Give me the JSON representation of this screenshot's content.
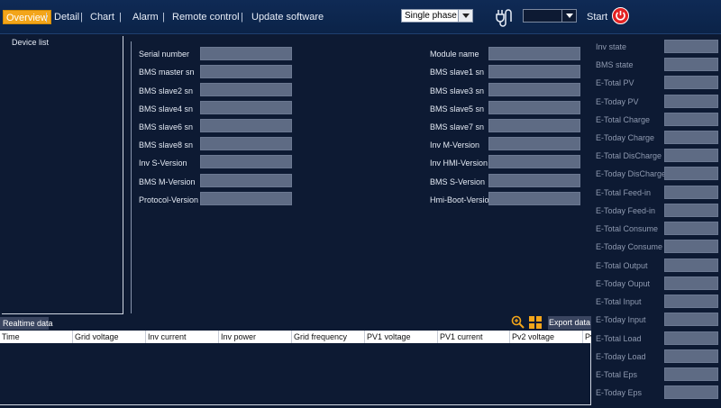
{
  "nav": {
    "tabs": [
      "Overview",
      "Detail",
      "Chart",
      "Alarm",
      "Remote control",
      "Update software"
    ],
    "phase_select": "Single phase",
    "port_select": "",
    "start_label": "Start"
  },
  "device_list": {
    "title": "Device list"
  },
  "info": {
    "left_labels": [
      "Serial number",
      "BMS master sn",
      "BMS slave2 sn",
      "BMS slave4 sn",
      "BMS slave6 sn",
      "BMS slave8 sn",
      "Inv S-Version",
      "BMS M-Version",
      "Protocol-Version"
    ],
    "right_labels": [
      "Module name",
      "BMS slave1 sn",
      "BMS slave3 sn",
      "BMS slave5 sn",
      "BMS slave7 sn",
      "Inv M-Version",
      "Inv HMI-Version",
      "BMS S-Version",
      "Hmi-Boot-Version"
    ]
  },
  "stats": {
    "labels": [
      "Inv state",
      "BMS state",
      "E-Total PV",
      "E-Today PV",
      "E-Total Charge",
      "E-Today Charge",
      "E-Total DisCharge",
      "E-Today DisCharge",
      "E-Total Feed-in",
      "E-Today Feed-in",
      "E-Total Consume",
      "E-Today Consume",
      "E-Total Output",
      "E-Today Ouput",
      "E-Total Input",
      "E-Today Input",
      "E-Total Load",
      "E-Today Load",
      "E-Total Eps",
      "E-Today Eps"
    ]
  },
  "realtime": {
    "tab_label": "Realtime data",
    "export_label": "Export data",
    "columns": [
      "Time",
      "Grid voltage",
      "Inv current",
      "Inv power",
      "Grid frequency",
      "PV1 voltage",
      "PV1 current",
      "Pv2 voltage",
      "Pv"
    ]
  }
}
